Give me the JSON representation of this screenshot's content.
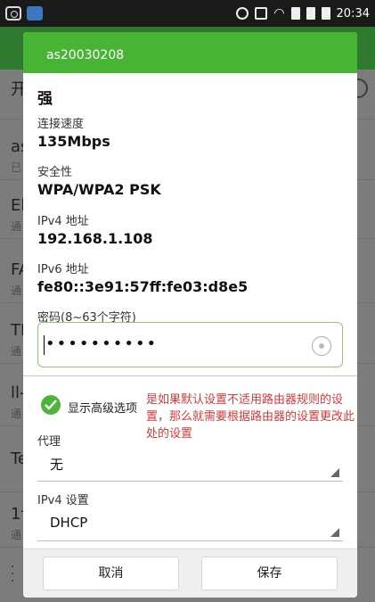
{
  "status_bar": {
    "time": "20:34",
    "icons": [
      "screenshot-icon",
      "cloud-icon",
      "alarm-icon",
      "signal-icon",
      "wifi-icon",
      "sim-icon",
      "sim2-icon",
      "battery-icon"
    ]
  },
  "background_list": {
    "header_partial": "开",
    "rows": [
      {
        "title": "as",
        "subtitle": "已"
      },
      {
        "title": "El",
        "subtitle": "通"
      },
      {
        "title": "FA",
        "subtitle": "通"
      },
      {
        "title": "TI",
        "subtitle": "通"
      },
      {
        "title": "ll-",
        "subtitle": "通"
      },
      {
        "title": "Te",
        "subtitle": ""
      },
      {
        "title": "1†",
        "subtitle": "通"
      }
    ]
  },
  "dialog": {
    "title": "as20030208",
    "signal_value": "强",
    "speed_label": "连接速度",
    "speed_value": "135Mbps",
    "security_label": "安全性",
    "security_value": "WPA/WPA2 PSK",
    "ipv4_label": "IPv4 地址",
    "ipv4_value": "192.168.1.108",
    "ipv6_label": "IPv6 地址",
    "ipv6_value": "fe80::3e91:57ff:fe03:d8e5",
    "password_label": "密码(8~63个字符)",
    "password_value": "••••••••••",
    "advanced_checkbox_label": "显示高级选项",
    "annotation": "是如果默认设置不适用路由器规则的设置，那么就需要根据路由器的设置更改此处的设置",
    "proxy_label": "代理",
    "proxy_value": "无",
    "ipv4_settings_label": "IPv4 设置",
    "ipv4_settings_value": "DHCP",
    "cancel_label": "取消",
    "save_label": "保存"
  },
  "colors": {
    "accent_green": "#47b533",
    "annotation_red": "#d43a3a"
  }
}
